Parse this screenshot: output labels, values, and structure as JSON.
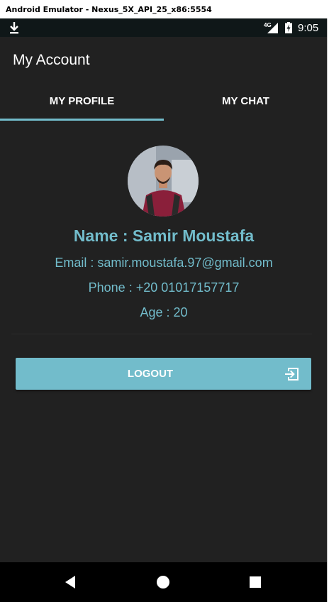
{
  "window": {
    "title": "Android Emulator - Nexus_5X_API_25_x86:5554"
  },
  "status_bar": {
    "network": "4G",
    "time": "9:05"
  },
  "toolbar": {
    "title": "My Account"
  },
  "tabs": [
    {
      "label": "MY PROFILE",
      "active": true
    },
    {
      "label": "MY CHAT",
      "active": false
    }
  ],
  "profile": {
    "name": "Name : Samir Moustafa",
    "email": "Email : samir.moustafa.97@gmail.com",
    "phone": "Phone : +20 01017157717",
    "age": "Age : 20"
  },
  "logout": {
    "label": "LOGOUT",
    "icon": "logout-icon"
  },
  "nav": {
    "back": "back-icon",
    "home": "home-icon",
    "recent": "recent-apps-icon"
  },
  "colors": {
    "accent": "#72bccb",
    "background": "#212121",
    "status_bar": "#0f1718"
  }
}
